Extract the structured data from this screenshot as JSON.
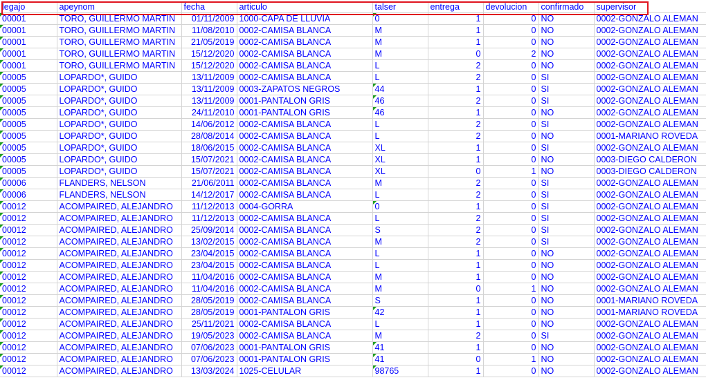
{
  "headers": [
    "legajo",
    "apeynom",
    "fecha",
    "articulo",
    "talser",
    "entrega",
    "devolucion",
    "confirmado",
    "supervisor"
  ],
  "rows": [
    [
      "00001",
      "TORO, GUILLERMO MARTIN",
      "01/11/2009",
      "1000-CAPA DE LLUVIA",
      "0",
      "1",
      "0",
      "NO",
      "0002-GONZALO ALEMAN"
    ],
    [
      "00001",
      "TORO, GUILLERMO MARTIN",
      "11/08/2010",
      "0002-CAMISA BLANCA",
      "M",
      "1",
      "0",
      "NO",
      "0002-GONZALO ALEMAN"
    ],
    [
      "00001",
      "TORO, GUILLERMO MARTIN",
      "21/05/2019",
      "0002-CAMISA BLANCA",
      "M",
      "1",
      "0",
      "NO",
      "0002-GONZALO ALEMAN"
    ],
    [
      "00001",
      "TORO, GUILLERMO MARTIN",
      "15/12/2020",
      "0002-CAMISA BLANCA",
      "M",
      "0",
      "2",
      "NO",
      "0002-GONZALO ALEMAN"
    ],
    [
      "00001",
      "TORO, GUILLERMO MARTIN",
      "15/12/2020",
      "0002-CAMISA BLANCA",
      "L",
      "2",
      "0",
      "NO",
      "0002-GONZALO ALEMAN"
    ],
    [
      "00005",
      "LOPARDO*, GUIDO",
      "13/11/2009",
      "0002-CAMISA BLANCA",
      "L",
      "2",
      "0",
      "SI",
      "0002-GONZALO ALEMAN"
    ],
    [
      "00005",
      "LOPARDO*, GUIDO",
      "13/11/2009",
      "0003-ZAPATOS NEGROS",
      "44",
      "1",
      "0",
      "SI",
      "0002-GONZALO ALEMAN"
    ],
    [
      "00005",
      "LOPARDO*, GUIDO",
      "13/11/2009",
      "0001-PANTALON GRIS",
      "46",
      "2",
      "0",
      "SI",
      "0002-GONZALO ALEMAN"
    ],
    [
      "00005",
      "LOPARDO*, GUIDO",
      "24/11/2010",
      "0001-PANTALON GRIS",
      "46",
      "1",
      "0",
      "NO",
      "0002-GONZALO ALEMAN"
    ],
    [
      "00005",
      "LOPARDO*, GUIDO",
      "14/06/2012",
      "0002-CAMISA BLANCA",
      "L",
      "2",
      "0",
      "SI",
      "0002-GONZALO ALEMAN"
    ],
    [
      "00005",
      "LOPARDO*, GUIDO",
      "28/08/2014",
      "0002-CAMISA BLANCA",
      "L",
      "2",
      "0",
      "NO",
      "0001-MARIANO ROVEDA"
    ],
    [
      "00005",
      "LOPARDO*, GUIDO",
      "18/06/2015",
      "0002-CAMISA BLANCA",
      "XL",
      "1",
      "0",
      "SI",
      "0002-GONZALO ALEMAN"
    ],
    [
      "00005",
      "LOPARDO*, GUIDO",
      "15/07/2021",
      "0002-CAMISA BLANCA",
      "XL",
      "1",
      "0",
      "NO",
      "0003-DIEGO CALDERON"
    ],
    [
      "00005",
      "LOPARDO*, GUIDO",
      "15/07/2021",
      "0002-CAMISA BLANCA",
      "XL",
      "0",
      "1",
      "NO",
      "0003-DIEGO CALDERON"
    ],
    [
      "00006",
      "FLANDERS, NELSON",
      "21/06/2011",
      "0002-CAMISA BLANCA",
      "M",
      "2",
      "0",
      "SI",
      "0002-GONZALO ALEMAN"
    ],
    [
      "00006",
      "FLANDERS, NELSON",
      "14/12/2017",
      "0002-CAMISA BLANCA",
      "L",
      "2",
      "0",
      "SI",
      "0002-GONZALO ALEMAN"
    ],
    [
      "00012",
      "ACOMPAIRED, ALEJANDRO",
      "11/12/2013",
      "0004-GORRA",
      "0",
      "1",
      "0",
      "SI",
      "0002-GONZALO ALEMAN"
    ],
    [
      "00012",
      "ACOMPAIRED, ALEJANDRO",
      "11/12/2013",
      "0002-CAMISA BLANCA",
      "L",
      "2",
      "0",
      "SI",
      "0002-GONZALO ALEMAN"
    ],
    [
      "00012",
      "ACOMPAIRED, ALEJANDRO",
      "25/09/2014",
      "0002-CAMISA BLANCA",
      "S",
      "2",
      "0",
      "SI",
      "0002-GONZALO ALEMAN"
    ],
    [
      "00012",
      "ACOMPAIRED, ALEJANDRO",
      "13/02/2015",
      "0002-CAMISA BLANCA",
      "M",
      "2",
      "0",
      "SI",
      "0002-GONZALO ALEMAN"
    ],
    [
      "00012",
      "ACOMPAIRED, ALEJANDRO",
      "23/04/2015",
      "0002-CAMISA BLANCA",
      "L",
      "1",
      "0",
      "NO",
      "0002-GONZALO ALEMAN"
    ],
    [
      "00012",
      "ACOMPAIRED, ALEJANDRO",
      "23/04/2015",
      "0002-CAMISA BLANCA",
      "L",
      "1",
      "0",
      "NO",
      "0002-GONZALO ALEMAN"
    ],
    [
      "00012",
      "ACOMPAIRED, ALEJANDRO",
      "11/04/2016",
      "0002-CAMISA BLANCA",
      "M",
      "1",
      "0",
      "NO",
      "0002-GONZALO ALEMAN"
    ],
    [
      "00012",
      "ACOMPAIRED, ALEJANDRO",
      "11/04/2016",
      "0002-CAMISA BLANCA",
      "M",
      "0",
      "1",
      "NO",
      "0002-GONZALO ALEMAN"
    ],
    [
      "00012",
      "ACOMPAIRED, ALEJANDRO",
      "28/05/2019",
      "0002-CAMISA BLANCA",
      "S",
      "1",
      "0",
      "NO",
      "0001-MARIANO ROVEDA"
    ],
    [
      "00012",
      "ACOMPAIRED, ALEJANDRO",
      "28/05/2019",
      "0001-PANTALON GRIS",
      "42",
      "1",
      "0",
      "NO",
      "0001-MARIANO ROVEDA"
    ],
    [
      "00012",
      "ACOMPAIRED, ALEJANDRO",
      "25/11/2021",
      "0002-CAMISA BLANCA",
      "L",
      "1",
      "0",
      "NO",
      "0002-GONZALO ALEMAN"
    ],
    [
      "00012",
      "ACOMPAIRED, ALEJANDRO",
      "19/05/2023",
      "0002-CAMISA BLANCA",
      "M",
      "2",
      "0",
      "SI",
      "0002-GONZALO ALEMAN"
    ],
    [
      "00012",
      "ACOMPAIRED, ALEJANDRO",
      "07/06/2023",
      "0001-PANTALON GRIS",
      "41",
      "1",
      "0",
      "NO",
      "0002-GONZALO ALEMAN"
    ],
    [
      "00012",
      "ACOMPAIRED, ALEJANDRO",
      "07/06/2023",
      "0001-PANTALON GRIS",
      "41",
      "0",
      "1",
      "NO",
      "0002-GONZALO ALEMAN"
    ],
    [
      "00012",
      "ACOMPAIRED, ALEJANDRO",
      "13/03/2024",
      "1025-CELULAR",
      "98765",
      "1",
      "0",
      "NO",
      "0002-GONZALO ALEMAN"
    ]
  ],
  "colors": {
    "text": "#0000ff",
    "grid": "#d4d4d4",
    "highlight": "#e0141e",
    "number_stored_as_text_marker": "#1e9e1e"
  }
}
